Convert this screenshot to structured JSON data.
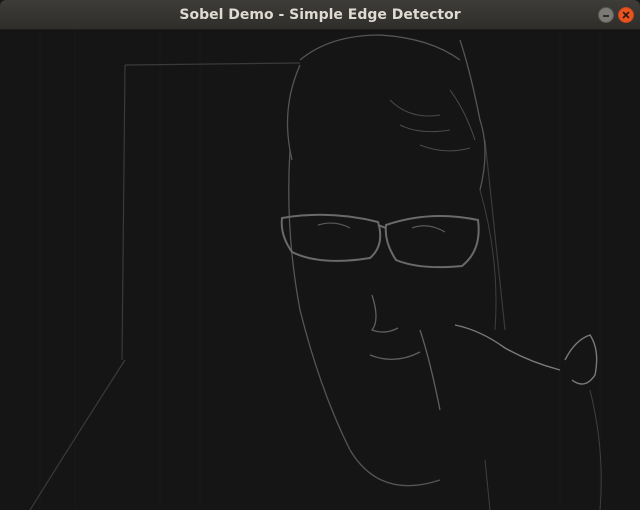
{
  "window": {
    "title": "Sobel Demo - Simple Edge Detector",
    "accent_close": "#e95420",
    "titlebar_bg": "#353430"
  },
  "controls": {
    "minimize_icon": "minimize-icon",
    "close_icon": "close-icon"
  },
  "content": {
    "image_description_type": "sobel-edge-output",
    "background": "#151515"
  }
}
